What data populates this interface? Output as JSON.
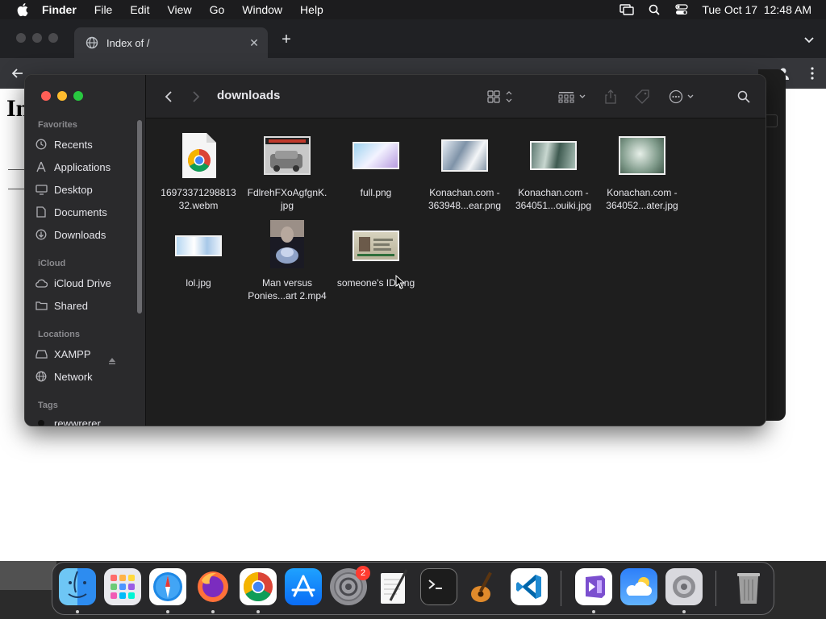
{
  "menubar": {
    "items": [
      "Finder",
      "File",
      "Edit",
      "View",
      "Go",
      "Window",
      "Help"
    ],
    "datetime": "Tue Oct 17  12:48 AM"
  },
  "browser": {
    "tab_title": "Index of /",
    "page_heading": "In"
  },
  "finder": {
    "title": "downloads",
    "sidebar": {
      "favorites_label": "Favorites",
      "favorites": [
        "Recents",
        "Applications",
        "Desktop",
        "Documents",
        "Downloads"
      ],
      "icloud_label": "iCloud",
      "icloud": [
        "iCloud Drive",
        "Shared"
      ],
      "locations_label": "Locations",
      "locations": [
        "XAMPP",
        "Network"
      ],
      "tags_label": "Tags",
      "tags": [
        "rewwrerer"
      ]
    },
    "files": [
      {
        "name": "16973371298813\n32.webm",
        "kind": "chrome-document"
      },
      {
        "name": "FdlrehFXoAgfgnK.\njpg",
        "kind": "image"
      },
      {
        "name": "full.png",
        "kind": "image"
      },
      {
        "name": "Konachan.com -\n363948...ear.png",
        "kind": "image"
      },
      {
        "name": "Konachan.com -\n364051...ouiki.jpg",
        "kind": "image"
      },
      {
        "name": "Konachan.com -\n364052...ater.jpg",
        "kind": "image"
      },
      {
        "name": "lol.jpg",
        "kind": "image"
      },
      {
        "name": "Man versus\nPonies...art 2.mp4",
        "kind": "video"
      },
      {
        "name": "someone's ID.png",
        "kind": "image"
      }
    ]
  },
  "dock": {
    "apps": [
      "finder-icon",
      "launchpad-icon",
      "safari-icon",
      "firefox-icon",
      "chrome-icon",
      "app-store-icon",
      "system-preferences-icon",
      "textedit-icon",
      "terminal-icon",
      "garageband-icon",
      "vscode-icon",
      "visual-studio-icon",
      "weather-icon",
      "settings-icon",
      "trash-icon"
    ],
    "settings_badge": "2"
  },
  "colors": {
    "accent_red": "#ff5f57",
    "accent_yellow": "#febc2e",
    "accent_green": "#28c840"
  }
}
